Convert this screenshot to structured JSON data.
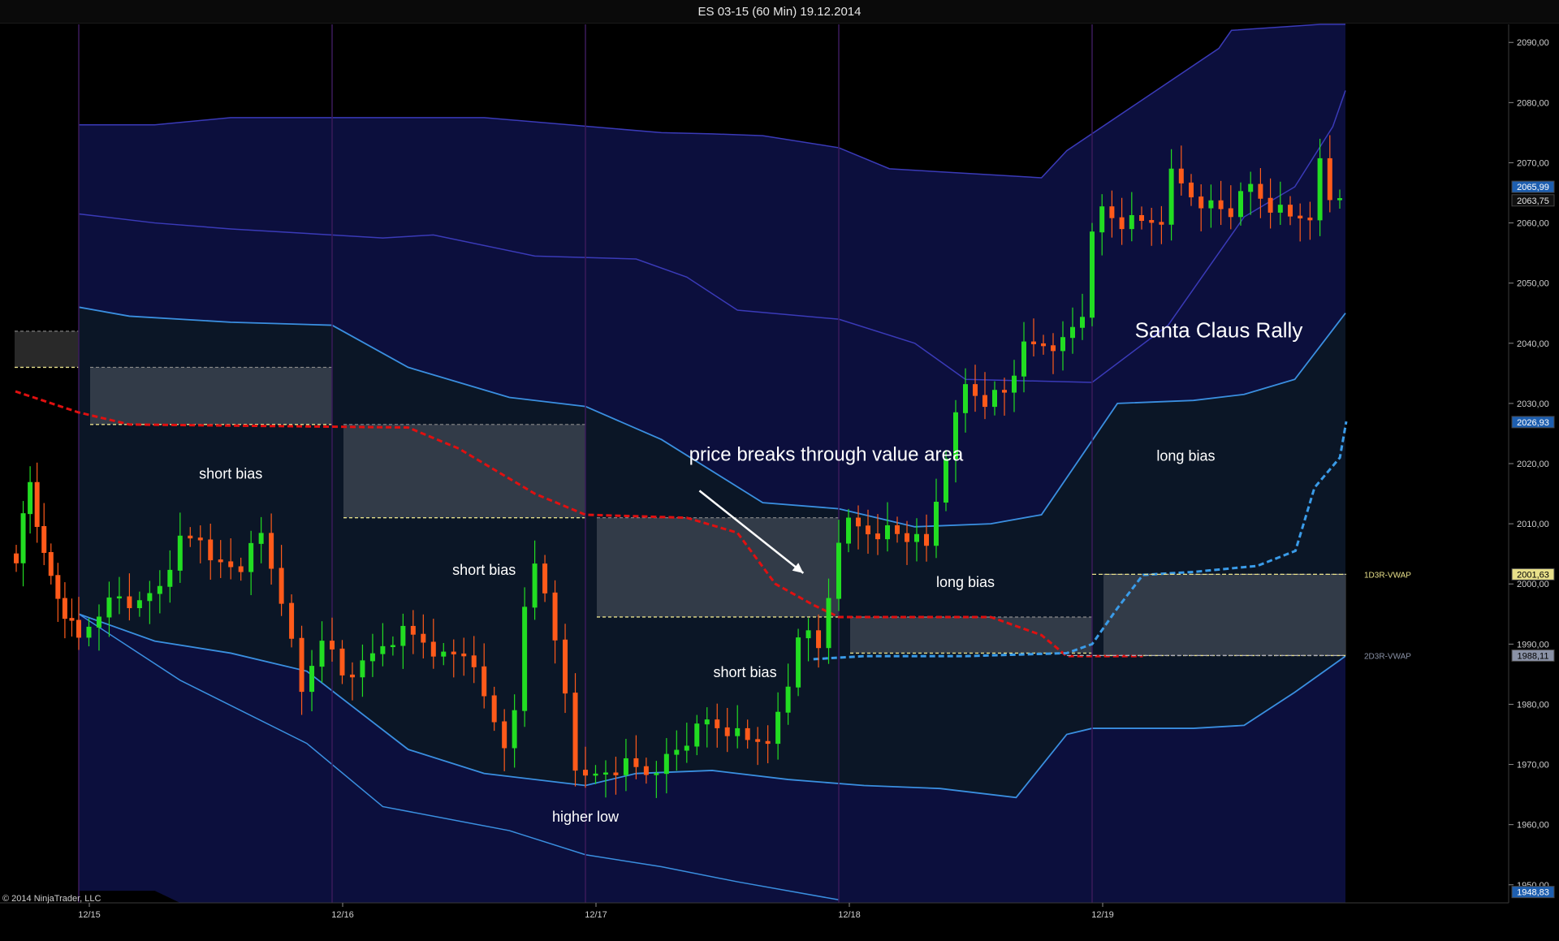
{
  "window": {
    "title": "ES 03-15 (60 Min)  19.12.2014"
  },
  "copyright": "© 2014 NinjaTrader, LLC",
  "colors": {
    "background": "#000000",
    "band_fill": "#0d1040",
    "band_line": "#3a3ab8",
    "inner_fill": "#0b1626",
    "inner_line": "#3a8fe0",
    "vwap_red": "#e01010",
    "vwap_blue": "#3a9be8",
    "up_candle": "#22dd22",
    "down_candle": "#ff5a1a",
    "session_divider": "#3a1a5a"
  },
  "chart_data": {
    "type": "candlestick",
    "instrument": "ES 03-15",
    "interval": "60 Min",
    "date": "19.12.2014",
    "ylim": [
      1947,
      2093
    ],
    "y_ticks": [
      2090,
      2080,
      2070,
      2060,
      2050,
      2040,
      2030,
      2020,
      2010,
      2000,
      1990,
      1980,
      1970,
      1960,
      1950
    ],
    "y_tick_labels": [
      "2090,00",
      "2080,00",
      "2070,00",
      "2060,00",
      "2050,00",
      "2040,00",
      "2030,00",
      "2020,00",
      "2010,00",
      "2000,00",
      "1990,00",
      "1980,00",
      "1970,00",
      "1960,00",
      "1950,00"
    ],
    "x_tick_labels": [
      "12/15",
      "12/16",
      "12/17",
      "12/18",
      "12/19"
    ],
    "price_markers": [
      {
        "label": "2065,99",
        "value": 2066.0,
        "style": "blue"
      },
      {
        "label": "2063,75",
        "value": 2063.75,
        "style": "dark"
      },
      {
        "label": "2026,93",
        "value": 2026.9,
        "style": "blue"
      },
      {
        "label": "2001,63",
        "value": 2001.6,
        "style": "yellow"
      },
      {
        "label": "1988,11",
        "value": 1988.1,
        "style": "gray"
      },
      {
        "label": "1948,83",
        "value": 1948.8,
        "style": "blue"
      }
    ],
    "reference_lines": [
      {
        "label": "1D3R-VWAP",
        "value": 2001.6
      },
      {
        "label": "2D3R-VWAP",
        "value": 1988.1
      }
    ],
    "value_areas": [
      {
        "day": 0,
        "high": 2042,
        "low": 2036
      },
      {
        "day": 1,
        "high": 2036,
        "low": 2026.5
      },
      {
        "day": 2,
        "high": 2026.5,
        "low": 2011
      },
      {
        "day": 3,
        "high": 2011,
        "low": 1994.5
      },
      {
        "day": 4,
        "high": 1994.5,
        "low": 1988.5
      },
      {
        "day": 5,
        "high": 2001.6,
        "low": 1988.1
      }
    ],
    "annotations": [
      {
        "text": "short bias",
        "x": 0.6,
        "y": 2017.5,
        "size": 18
      },
      {
        "text": "short bias",
        "x": 1.6,
        "y": 2001.5,
        "size": 18
      },
      {
        "text": "short bias",
        "x": 2.63,
        "y": 1984.5,
        "size": 18
      },
      {
        "text": "higher low",
        "x": 2.0,
        "y": 1960.5,
        "size": 18
      },
      {
        "text": "price breaks through value area",
        "x": 2.95,
        "y": 2020.5,
        "size": 24
      },
      {
        "text": "long bias",
        "x": 3.5,
        "y": 1999.5,
        "size": 18
      },
      {
        "text": "long bias",
        "x": 4.37,
        "y": 2020.5,
        "size": 18
      },
      {
        "text": "Santa Claus Rally",
        "x": 4.5,
        "y": 2041,
        "size": 26
      }
    ],
    "arrow": {
      "from": [
        2.45,
        2015.5
      ],
      "to": [
        2.86,
        2001.8
      ]
    }
  }
}
